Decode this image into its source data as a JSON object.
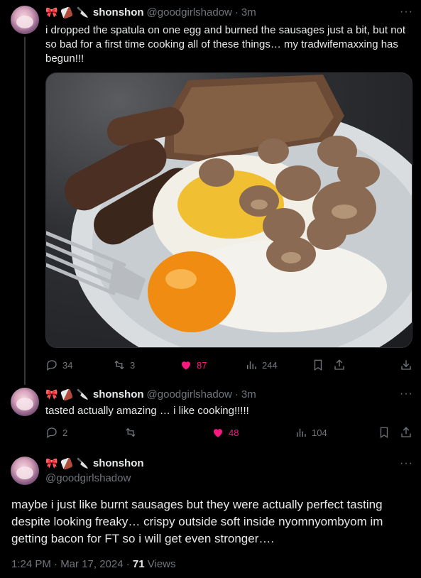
{
  "tweets": [
    {
      "name": "shonshon",
      "handle": "@goodgirlshadow",
      "time": "3m",
      "text": "i dropped the spatula on one egg and burned the sausages just a bit, but not so bad for a first time cooking all of these things… my tradwifemaxxing has begun!!!",
      "stats": {
        "replies": "34",
        "reposts": "3",
        "likes": "87",
        "views": "244"
      }
    },
    {
      "name": "shonshon",
      "handle": "@goodgirlshadow",
      "time": "3m",
      "text": "tasted actually amazing … i like cooking!!!!!",
      "stats": {
        "replies": "2",
        "reposts": "",
        "likes": "48",
        "views": "104"
      }
    }
  ],
  "main": {
    "name": "shonshon",
    "handle": "@goodgirlshadow",
    "text": "maybe i just like burnt sausages but they were actually perfect tasting despite looking freaky… crispy outside soft inside nyomnyombyom im getting bacon for FT so i will get even stronger….",
    "time": "1:24 PM · Mar 17, 2024 · ",
    "views_count": "71",
    "views_label": " Views"
  },
  "icons": [
    "ribbon-icon",
    "chocolate-icon",
    "knife-icon",
    "more-icon",
    "reply-icon",
    "repost-icon",
    "heart-icon",
    "views-icon",
    "bookmark-icon",
    "share-icon",
    "download-icon"
  ],
  "colors": {
    "background": "#000000",
    "text": "#e7e9ea",
    "muted": "#71767b",
    "like": "#f91880",
    "divider": "#2f3336"
  }
}
